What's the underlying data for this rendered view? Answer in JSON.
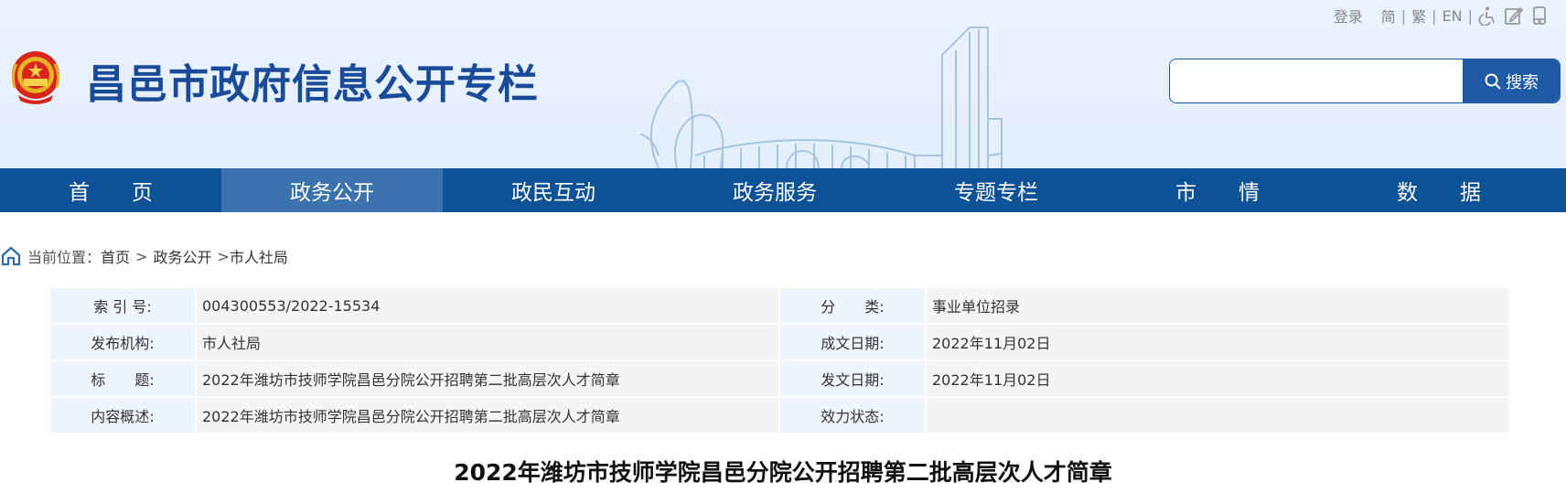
{
  "header": {
    "site_title": "昌邑市政府信息公开专栏",
    "top_links": {
      "login": "登录",
      "simplified": "简",
      "sep": "|",
      "traditional": "繁",
      "english": "EN"
    },
    "search": {
      "placeholder": "",
      "value": "",
      "button_label": "搜索"
    }
  },
  "nav": {
    "items": [
      {
        "label": "首　　页"
      },
      {
        "label": "政务公开"
      },
      {
        "label": "政民互动"
      },
      {
        "label": "政务服务"
      },
      {
        "label": "专题专栏"
      },
      {
        "label": "市　　情"
      },
      {
        "label": "数　　据"
      }
    ],
    "active_index": 1
  },
  "breadcrumb": {
    "prefix": "当前位置：",
    "items": [
      "首页",
      "政务公开",
      "市人社局"
    ],
    "sep": ">"
  },
  "info": {
    "rows": [
      {
        "label1": "索 引 号:",
        "value1": "004300553/2022-15534",
        "label2": "分　　类:",
        "value2": "事业单位招录"
      },
      {
        "label1": "发布机构:",
        "value1": "市人社局",
        "label2": "成文日期:",
        "value2": "2022年11月02日"
      },
      {
        "label1": "标　　题:",
        "value1": "2022年潍坊市技师学院昌邑分院公开招聘第二批高层次人才简章",
        "label2": "发文日期:",
        "value2": "2022年11月02日"
      },
      {
        "label1": "内容概述:",
        "value1": "2022年潍坊市技师学院昌邑分院公开招聘第二批高层次人才简章",
        "label2": "效力状态:",
        "value2": ""
      }
    ]
  },
  "article": {
    "title": "2022年潍坊市技师学院昌邑分院公开招聘第二批高层次人才简章"
  },
  "colors": {
    "brand_blue": "#1a4a98",
    "nav_bg": "#0d5297",
    "nav_active": "#3a73ad",
    "header_bg": "#eaf3fd"
  },
  "icons": [
    "national-emblem-icon",
    "accessibility-icon",
    "edit-icon",
    "mobile-icon",
    "search-icon",
    "home-icon"
  ]
}
